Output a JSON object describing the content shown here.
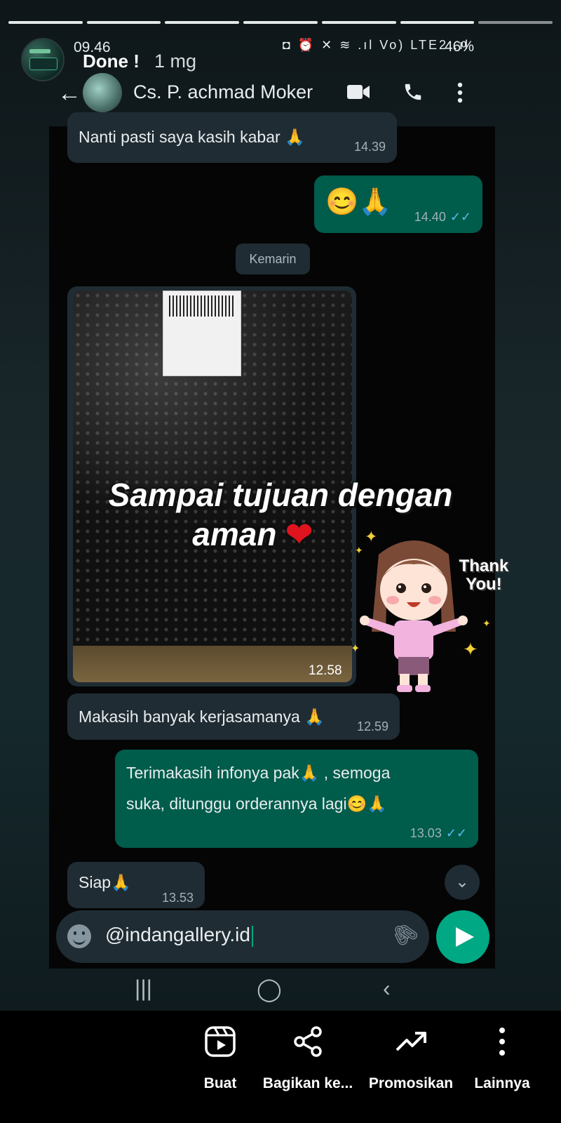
{
  "story": {
    "author": "Done !",
    "posted_ago": "1 mg",
    "status_time": "09.46",
    "status_icons": "◘ ⏰ ✕ ≋ .ıl Vo) LTE2 .ıl",
    "battery": "46%"
  },
  "chat_header": {
    "contact_name": "Cs. P. achmad Moker",
    "back_icon": "arrow-back-icon",
    "video_icon": "video-call-icon",
    "phone_icon": "phone-icon",
    "menu_icon": "more-vert-icon"
  },
  "messages": {
    "m1": {
      "text": "Nanti pasti saya kasih kabar 🙏",
      "time": "14.39",
      "direction": "in"
    },
    "m2": {
      "text": "😊🙏",
      "time": "14.40",
      "direction": "out",
      "read": true
    },
    "date_divider": "Kemarin",
    "photo": {
      "time": "12.58",
      "direction": "in"
    },
    "m3": {
      "text": "Makasih banyak kerjasamanya 🙏",
      "time": "12.59",
      "direction": "in"
    },
    "m4": {
      "line1": "Terimakasih infonya pak🙏 , semoga",
      "line2": "suka, ditunggu orderannya lagi😊🙏",
      "time": "13.03",
      "direction": "out",
      "read": true
    },
    "m5": {
      "text": "Siap🙏",
      "time": "13.53",
      "direction": "in"
    }
  },
  "overlay": {
    "line1": "Sampai tujuan dengan",
    "line2": "aman",
    "heart": "❤",
    "sticker_text_1": "Thank",
    "sticker_text_2": "You!"
  },
  "composer": {
    "text": "@indangallery.id"
  },
  "nav": {
    "recents": "|||",
    "home": "◯",
    "back": "‹"
  },
  "actions": [
    {
      "label": "Buat",
      "icon": "reel-icon"
    },
    {
      "label": "Bagikan ke...",
      "icon": "share-icon"
    },
    {
      "label": "Promosikan",
      "icon": "trending-up-icon"
    },
    {
      "label": "Lainnya",
      "icon": "more-vert-icon"
    }
  ],
  "colors": {
    "incoming_bubble": "#202c33",
    "outgoing_bubble": "#005c4b",
    "accent": "#00a884",
    "read_ticks": "#53bdeb"
  }
}
